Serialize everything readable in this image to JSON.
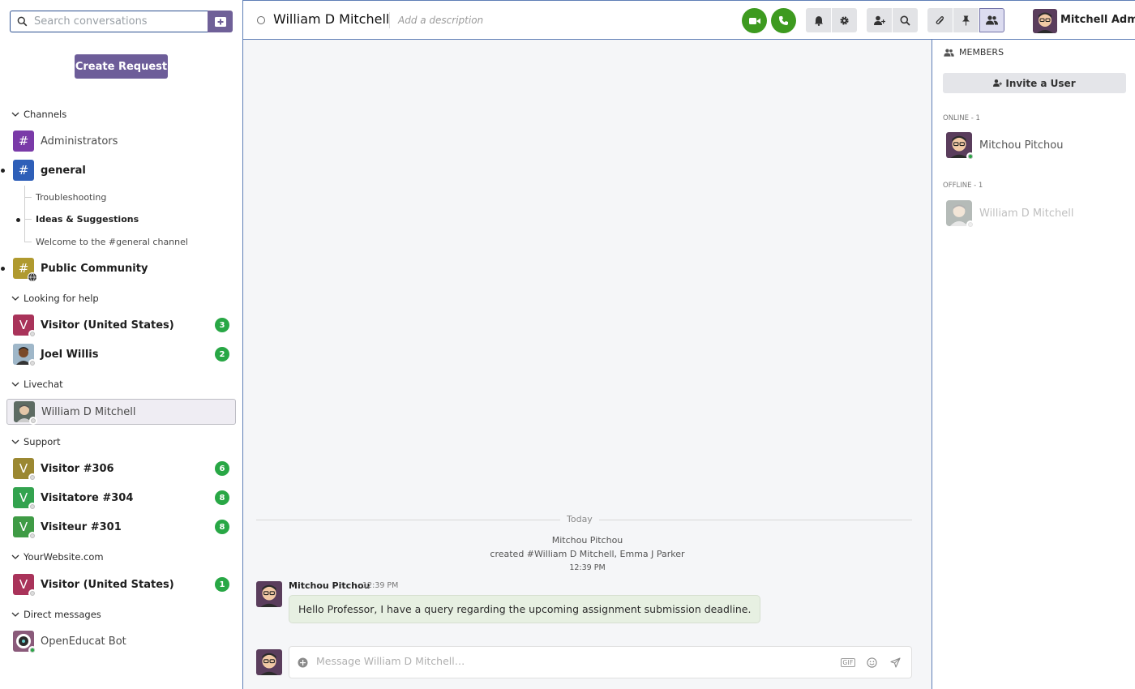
{
  "sidebar": {
    "search_placeholder": "Search conversations",
    "create_request_label": "Create Request",
    "categories": {
      "channels": "Channels",
      "looking_for_help": "Looking for help",
      "livechat": "Livechat",
      "support": "Support",
      "yourwebsite": "YourWebsite.com",
      "direct_messages": "Direct messages"
    },
    "channels": {
      "administrators": "Administrators",
      "general": "general",
      "general_threads": [
        "Troubleshooting",
        "Ideas & Suggestions",
        "Welcome to the #general channel"
      ],
      "public_community": "Public Community"
    },
    "looking_for_help": [
      {
        "name": "Visitor (United States)",
        "initial": "V",
        "badge": "3",
        "color": "#a9335a"
      },
      {
        "name": "Joel Willis",
        "initial": "",
        "badge": "2",
        "color": "#6b4a2b"
      }
    ],
    "livechat": [
      {
        "name": "William D Mitchell"
      }
    ],
    "support": [
      {
        "name": "Visitor #306",
        "initial": "V",
        "badge": "6",
        "color": "#9b8832"
      },
      {
        "name": "Visitatore #304",
        "initial": "V",
        "badge": "8",
        "color": "#33a34f"
      },
      {
        "name": "Visiteur #301",
        "initial": "V",
        "badge": "8",
        "color": "#3f9b45"
      }
    ],
    "yourwebsite": [
      {
        "name": "Visitor (United States)",
        "initial": "V",
        "badge": "1",
        "color": "#a9335a"
      }
    ],
    "direct_messages": [
      {
        "name": "OpenEducat Bot"
      }
    ]
  },
  "header": {
    "title": "William D Mitchell",
    "description_placeholder": "Add a description",
    "user_name": "Mitchell Admin"
  },
  "chat": {
    "date_label": "Today",
    "notification": {
      "author": "Mitchou Pitchou",
      "text": "created #William D Mitchell, Emma J Parker",
      "time": "12:39 PM"
    },
    "message": {
      "author": "Mitchou Pitchou",
      "time": "12:39 PM",
      "text": "Hello Professor, I have a query regarding the upcoming assignment submission deadline."
    },
    "composer_placeholder": "Message William D Mitchell…",
    "gif_label": "GIF"
  },
  "members": {
    "title": "MEMBERS",
    "invite_label": "Invite a User",
    "online_label": "ONLINE - 1",
    "offline_label": "OFFLINE - 1",
    "online": [
      {
        "name": "Mitchou Pitchou"
      }
    ],
    "offline": [
      {
        "name": "William D Mitchell"
      }
    ]
  },
  "colors": {
    "accent": "#6d5d99",
    "call_green": "#3d9a1f",
    "badge_green": "#28a745",
    "admin_channel": "#7a3aa8",
    "general_channel": "#2e5fb8",
    "public_channel": "#b09a2f"
  }
}
